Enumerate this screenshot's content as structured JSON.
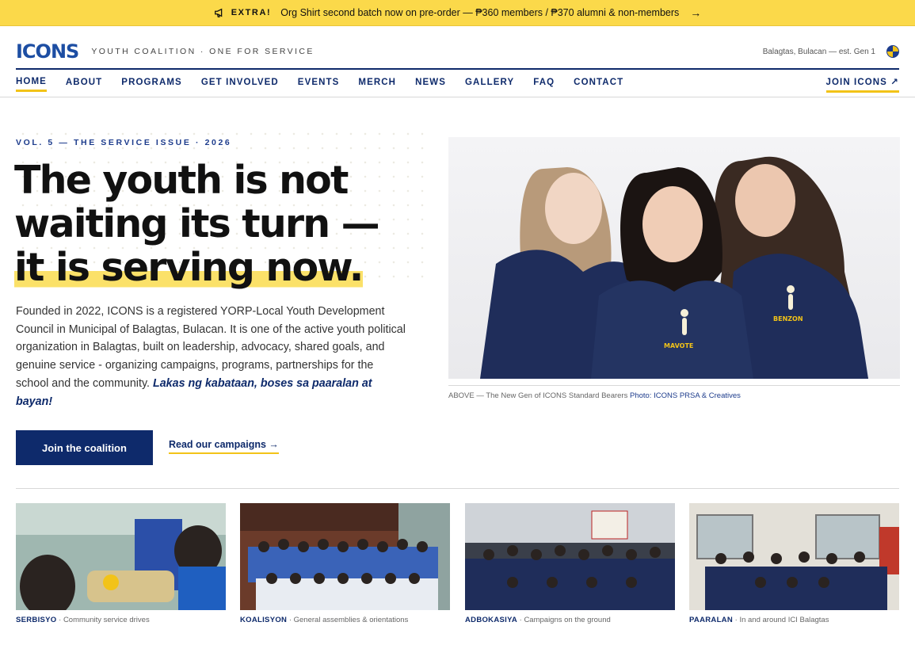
{
  "announcement": {
    "label": "EXTRA!",
    "text": "Org Shirt second batch now on pre-order — ₱360 members / ₱370 alumni & non-members",
    "icon": "megaphone-icon"
  },
  "header": {
    "logo_text": "ICONS",
    "tagline": "YOUTH COALITION · ONE FOR SERVICE",
    "location": "Balagtas, Bulacan — est. Gen 1"
  },
  "nav": {
    "items": [
      "HOME",
      "ABOUT",
      "PROGRAMS",
      "GET INVOLVED",
      "EVENTS",
      "MERCH",
      "NEWS",
      "GALLERY",
      "FAQ",
      "CONTACT"
    ],
    "active": "HOME",
    "join_label": "JOIN ICONS ↗"
  },
  "hero": {
    "kicker": "VOL. 5 — THE SERVICE ISSUE · 2026",
    "headline_line1": "The youth is not",
    "headline_line2": "waiting its turn —",
    "headline_line3": "it is serving now.",
    "intro": "Founded in 2022, ICONS is a registered YORP-Local Youth Development Council in Municipal of Balagtas, Bulacan. It is one of the active youth political organization in Balagtas, built on leadership, advocacy, shared goals, and genuine service - organizing campaigns, programs, partnerships for the school and the community.",
    "intro_emphasis": "Lakas ng kabataan, boses sa paaralan at bayan!",
    "cta_primary": "Join the coalition",
    "cta_secondary": "Read our campaigns →"
  },
  "photo": {
    "caption": "ABOVE — The New Gen of ICONS Standard Bearers",
    "credit": "Photo: ICONS PRSA & Creatives",
    "shirt_labels": [
      "MAVOTE",
      "BENZON"
    ]
  },
  "gallery": [
    {
      "tag": "SERBISYO",
      "desc": "· Community service drives"
    },
    {
      "tag": "KOALISYON",
      "desc": "· General assemblies & orientations"
    },
    {
      "tag": "ADBOKASIYA",
      "desc": "· Campaigns on the ground"
    },
    {
      "tag": "PAARALAN",
      "desc": "· In and around ICI Balagtas"
    }
  ],
  "colors": {
    "navy": "#0e2a6b",
    "yellow": "#fbd94a",
    "accent_yellow": "#f2c318",
    "brand_blue": "#1d4ea3"
  }
}
